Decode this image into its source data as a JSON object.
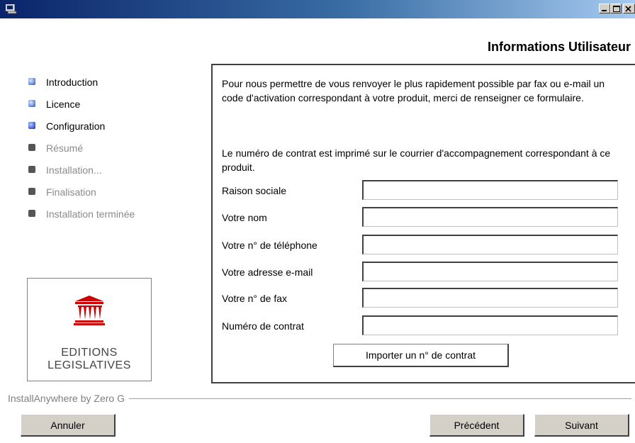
{
  "window": {
    "title": ""
  },
  "header": {
    "title": "Informations Utilisateur"
  },
  "steps": [
    {
      "label": "Introduction",
      "state": "done"
    },
    {
      "label": "Licence",
      "state": "done"
    },
    {
      "label": "Configuration",
      "state": "current"
    },
    {
      "label": "Résumé",
      "state": "pending"
    },
    {
      "label": "Installation...",
      "state": "pending"
    },
    {
      "label": "Finalisation",
      "state": "pending"
    },
    {
      "label": "Installation terminée",
      "state": "pending"
    }
  ],
  "logo": {
    "line1": "EDITIONS",
    "line2": "LEGISLATIVES",
    "color": "#cc0000"
  },
  "content": {
    "intro": "Pour nous permettre de vous renvoyer le plus rapidement possible par fax ou e-mail un code d'activation correspondant à votre produit, merci de renseigner ce formulaire.",
    "note": "Le numéro de contrat est imprimé sur le courrier d'accompagnement correspondant à ce produit.",
    "fields": [
      {
        "label": "Raison sociale",
        "value": ""
      },
      {
        "label": "Votre nom",
        "value": ""
      },
      {
        "label": "Votre n° de téléphone",
        "value": ""
      },
      {
        "label": "Votre adresse e-mail",
        "value": ""
      },
      {
        "label": "Votre n° de fax",
        "value": ""
      },
      {
        "label": "Numéro de contrat",
        "value": ""
      }
    ],
    "import_button": "Importer un n° de contrat"
  },
  "footer": {
    "brand": "InstallAnywhere by Zero G",
    "cancel": "Annuler",
    "previous": "Précédent",
    "next": "Suivant"
  },
  "colors": {
    "titlebar_start": "#0a246a",
    "titlebar_end": "#a6caf0",
    "button_face": "#d4d0c8"
  }
}
